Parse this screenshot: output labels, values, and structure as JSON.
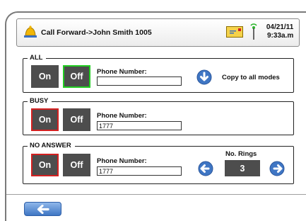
{
  "header": {
    "title": "Call Forward->John Smith 1005",
    "date": "04/21/11",
    "time": "9:33a.m"
  },
  "sections": {
    "all": {
      "label": "ALL",
      "on_label": "On",
      "off_label": "Off",
      "selected": "Off",
      "phone_label": "Phone Number:",
      "phone_value": "",
      "copy_label": "Copy to all modes"
    },
    "busy": {
      "label": "BUSY",
      "on_label": "On",
      "off_label": "Off",
      "selected": "On",
      "phone_label": "Phone Number:",
      "phone_value": "1777"
    },
    "no_answer": {
      "label": "NO ANSWER",
      "on_label": "On",
      "off_label": "Off",
      "selected": "On",
      "phone_label": "Phone Number:",
      "phone_value": "1777",
      "rings_label": "No. Rings",
      "rings_value": "3"
    }
  },
  "icons": {
    "alarm": "alarm-bell-icon",
    "message": "envelope-icon",
    "signal": "antenna-icon",
    "copy": "arrow-down-circle-icon",
    "rings_decrease": "arrow-left-circle-icon",
    "rings_increase": "arrow-right-circle-icon",
    "back": "arrow-left-icon"
  },
  "colors": {
    "button_bg": "#4d4d4d",
    "selected_green": "#22cc22",
    "selected_red": "#d42020",
    "accent_blue": "#3f76c4"
  }
}
